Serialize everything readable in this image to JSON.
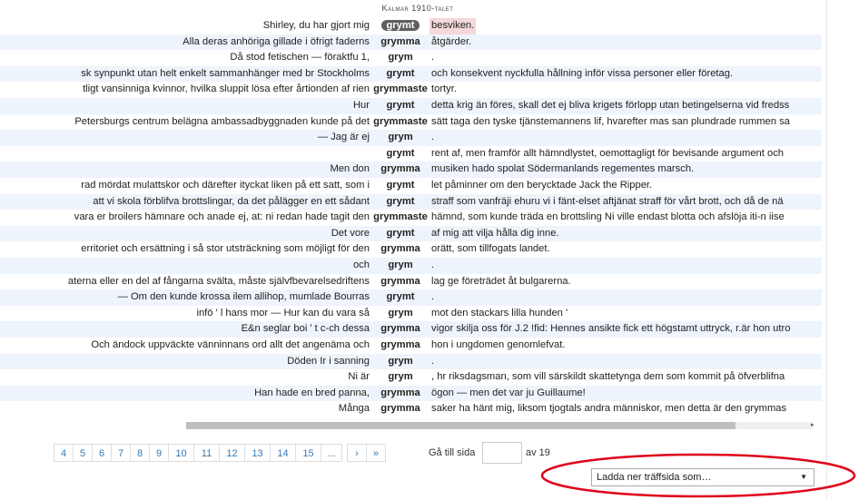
{
  "header": {
    "title": "Kalmar 1910-talet"
  },
  "rows": [
    {
      "left": "Shirley, du har gjort mig",
      "kw": "grymt",
      "right": "besviken."
    },
    {
      "left": "Alla deras anhöriga gillade i öfrigt faderns",
      "kw": "grymma",
      "right": "åtgärder."
    },
    {
      "left": "Då stod fetischen — föraktfu 1,",
      "kw": "grym",
      "right": "."
    },
    {
      "left": "sk synpunkt utan helt enkelt sammanhänger med br Stockholms",
      "kw": "grymt",
      "right": "och konsekvent nyckfulla hållning inför vissa personer eller företag."
    },
    {
      "left": "tligt vansinniga kvinnor, hvilka sluppit lösa efter årtionden af rien",
      "kw": "grymmaste",
      "right": "tortyr."
    },
    {
      "left": "Hur",
      "kw": "grymt",
      "right": "detta krig än föres, skall det ej bliva krigets förlopp utan betingelserna vid fredss"
    },
    {
      "left": "Petersburgs centrum belägna ambassadbyggnaden kunde på det",
      "kw": "grymmaste",
      "right": "sätt taga den tyske tjänstemannens lif, hvarefter mas san plundrade rummen sa"
    },
    {
      "left": "— Jag är ej",
      "kw": "grym",
      "right": "."
    },
    {
      "left": "",
      "kw": "grymt",
      "right": "rent af, men framför allt hämndlystet, oemottagligt för bevisande argument och"
    },
    {
      "left": "Men don",
      "kw": "grymma",
      "right": "musiken hado spolat Södermanlands regementes marsch."
    },
    {
      "left": "rad mördat mulattskor och därefter ityckat liken på ett satt, som i",
      "kw": "grymt",
      "right": "let påminner om den berycktade Jack the Ripper."
    },
    {
      "left": "att vi skola förblifva brottslingar, da det pålägger en ett sådant",
      "kw": "grymt",
      "right": "straff som vanfräji ehuru vi i fänt-elset aftjänat straff för vårt brott, och då de nä"
    },
    {
      "left": "vara er broilers hämnare och anade ej, at: ni redan hade tagit den",
      "kw": "grymmaste",
      "right": "hämnd, som kunde träda en brottsling Ni ville endast blotta och afslöja iti-n iise"
    },
    {
      "left": "Det vore",
      "kw": "grymt",
      "right": "af mig att vilja hålla dig inne."
    },
    {
      "left": "erritoriet och ersättning i så stor utsträckning som möjligt för den",
      "kw": "grymma",
      "right": "orätt, som tillfogats landet."
    },
    {
      "left": "och",
      "kw": "grym",
      "right": "."
    },
    {
      "left": "aterna eller en del af fångarna svälta, måste självfbevarelsedriftens",
      "kw": "grymma",
      "right": "lag ge företrädet åt bulgarerna."
    },
    {
      "left": "— Om den kunde krossa ilem allihop, mumlade Bourras",
      "kw": "grymt",
      "right": "."
    },
    {
      "left": "infö ' l hans mor — Hur kan du vara så",
      "kw": "grym",
      "right": "mot den stackars lilla hunden '"
    },
    {
      "left": "E&n seglar boi ' t c-ch dessa",
      "kw": "grymma",
      "right": "vigor skilja oss för J.2 !fid: Hennes ansikte fick ett högstamt uttryck, r.är hon utro"
    },
    {
      "left": "Och ändock uppväckte vänninnans ord allt det angenäma och",
      "kw": "grymma",
      "right": "hon i ungdomen genomlefvat."
    },
    {
      "left": "Döden Ir i sanning",
      "kw": "grym",
      "right": "."
    },
    {
      "left": "Ni är",
      "kw": "grym",
      "right": ", hr riksdagsman, som vill särskildt skattetynga dem som kommit på öfverblifna"
    },
    {
      "left": "Han hade en bred panna,",
      "kw": "grymma",
      "right": "ögon — men det var ju Guillaume!"
    },
    {
      "left": "Många",
      "kw": "grymma",
      "right": "saker ha hänt mig, liksom tjogtals andra människor, men detta är den grymmas"
    }
  ],
  "pagination": {
    "pages": [
      "4",
      "5",
      "6",
      "7",
      "8",
      "9",
      "10",
      "11",
      "12",
      "13",
      "14",
      "15",
      "..."
    ],
    "next": "›",
    "last": "»",
    "goto_label": "Gå till sida",
    "goto_value": "",
    "of_label": "av 19"
  },
  "download": {
    "label": "Ladda ner träffsida som…"
  },
  "colors": {
    "row_alt": "#eef4fb",
    "highlight": "#f6d8d8",
    "selected_kw": "#5f5f5f",
    "annotation": "#e0001a",
    "link": "#337ab7"
  }
}
